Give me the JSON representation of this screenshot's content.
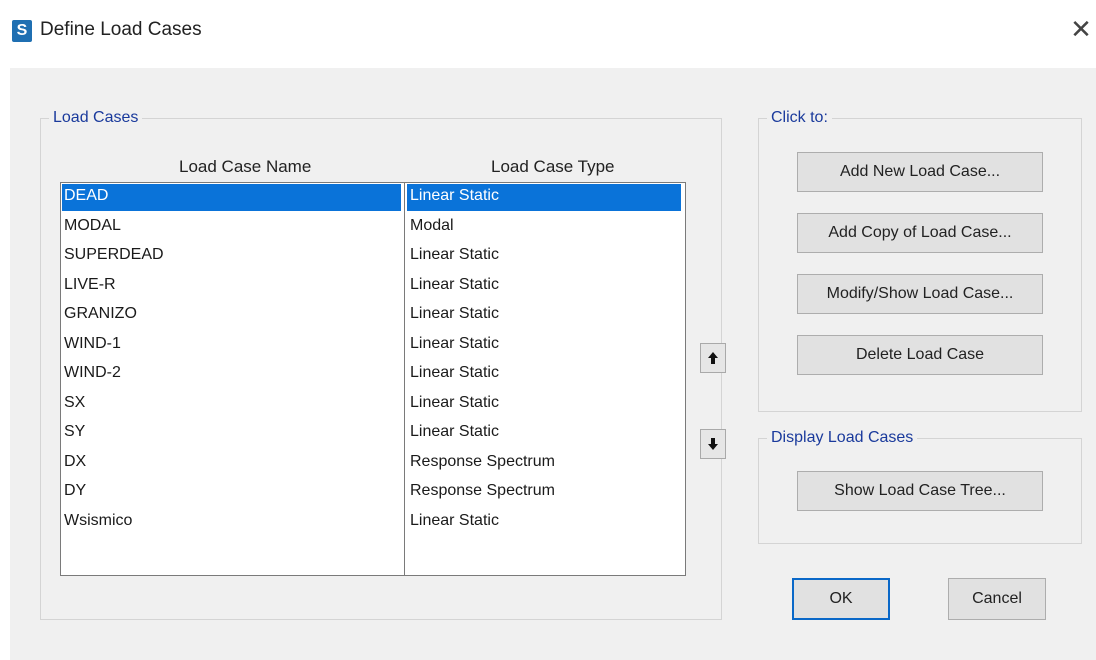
{
  "window": {
    "icon_letter": "S",
    "title": "Define Load Cases",
    "close_glyph": "✕"
  },
  "load_cases": {
    "group_label": "Load Cases",
    "col_name": "Load Case Name",
    "col_type": "Load Case Type",
    "selected_index": 0,
    "rows": [
      {
        "name": "DEAD",
        "type": "Linear Static"
      },
      {
        "name": "MODAL",
        "type": "Modal"
      },
      {
        "name": "SUPERDEAD",
        "type": "Linear Static"
      },
      {
        "name": "LIVE-R",
        "type": "Linear Static"
      },
      {
        "name": "GRANIZO",
        "type": "Linear Static"
      },
      {
        "name": "WIND-1",
        "type": "Linear Static"
      },
      {
        "name": "WIND-2",
        "type": "Linear Static"
      },
      {
        "name": "SX",
        "type": "Linear Static"
      },
      {
        "name": "SY",
        "type": "Linear Static"
      },
      {
        "name": "DX",
        "type": "Response Spectrum"
      },
      {
        "name": "DY",
        "type": "Response Spectrum"
      },
      {
        "name": "Wsismico",
        "type": "Linear Static"
      }
    ]
  },
  "reorder": {
    "up_icon": "arrow-up-icon",
    "down_icon": "arrow-down-icon"
  },
  "click_to": {
    "group_label": "Click to:",
    "add_new": "Add New Load Case...",
    "add_copy": "Add Copy of Load Case...",
    "modify_show": "Modify/Show Load Case...",
    "delete": "Delete Load Case"
  },
  "display": {
    "group_label": "Display Load Cases",
    "show_tree": "Show Load Case Tree..."
  },
  "footer": {
    "ok": "OK",
    "cancel": "Cancel"
  },
  "colors": {
    "selection": "#0a73d9",
    "legend_text": "#1a3a9c",
    "dialog_bg": "#f0f0f0"
  }
}
